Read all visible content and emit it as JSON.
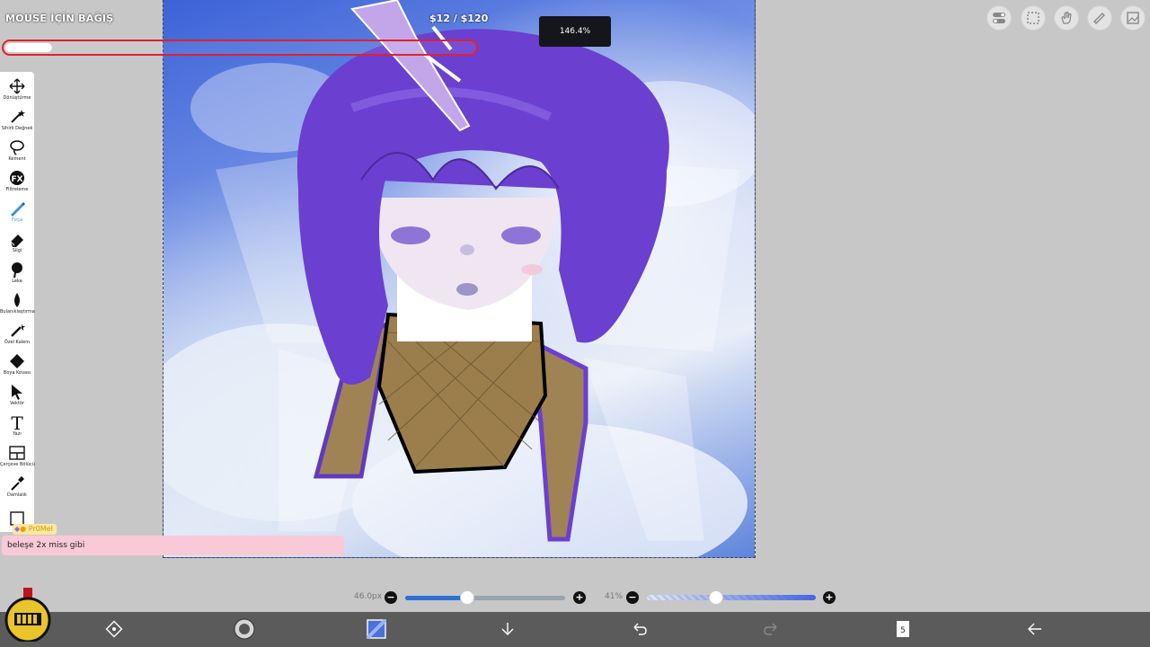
{
  "donation": {
    "title": "MOUSE İÇİN BAĞIŞ",
    "amount": "$12 / $120",
    "progress": 0.1
  },
  "zoom": "146.4%",
  "tools": [
    {
      "name": "transform",
      "label": "Dönüştürme",
      "icon": "move-icon"
    },
    {
      "name": "magic-wand",
      "label": "Sihirli Değnek",
      "icon": "magic-wand-icon"
    },
    {
      "name": "lasso",
      "label": "Kement",
      "icon": "lasso-icon"
    },
    {
      "name": "filter",
      "label": "Filtreleme",
      "icon": "fx-icon"
    },
    {
      "name": "brush",
      "label": "Fırça",
      "icon": "brush-icon",
      "active": true
    },
    {
      "name": "eraser",
      "label": "Silgi",
      "icon": "eraser-icon"
    },
    {
      "name": "smudge",
      "label": "Leke",
      "icon": "smudge-icon"
    },
    {
      "name": "blur",
      "label": "Bulanıklaştırma",
      "icon": "blur-drop-icon"
    },
    {
      "name": "special-pen",
      "label": "Özel Kalem",
      "icon": "special-pen-icon"
    },
    {
      "name": "paint-bucket",
      "label": "Boya Kovası",
      "icon": "bucket-icon"
    },
    {
      "name": "vector",
      "label": "Vektör",
      "icon": "vector-arrow-icon"
    },
    {
      "name": "text",
      "label": "Yazı",
      "icon": "text-icon"
    },
    {
      "name": "frame-divider",
      "label": "Çerçeve Bölücü",
      "icon": "frame-divider-icon"
    },
    {
      "name": "eyedropper",
      "label": "Damlalık",
      "icon": "eyedropper-icon"
    }
  ],
  "chat": {
    "user": "Pr0Mel",
    "message": "beleşe 2x miss gibi"
  },
  "sliders": {
    "size_value": "46.0px",
    "size_level": 0.39,
    "opacity_value": "41%",
    "opacity_level": 0.41
  },
  "top_right_icons": [
    "toggle-icon",
    "selection-icon",
    "hand-icon",
    "ruler-icon",
    "image-icon"
  ],
  "bottom_bar": {
    "icons": [
      "transform-modify-icon",
      "brush-preview-icon",
      "color-swatch-icon",
      "import-down-icon",
      "undo-icon",
      "redo-icon",
      "layers-icon",
      "back-icon"
    ],
    "layer_count": "5"
  },
  "colors": {
    "donation_border": "#e0212d",
    "active_tool": "#3a8ee6",
    "slider_blue": "#2d6fd6",
    "bottom_bar": "#5b5b5b",
    "hair_purple": "#6b3fd0"
  }
}
